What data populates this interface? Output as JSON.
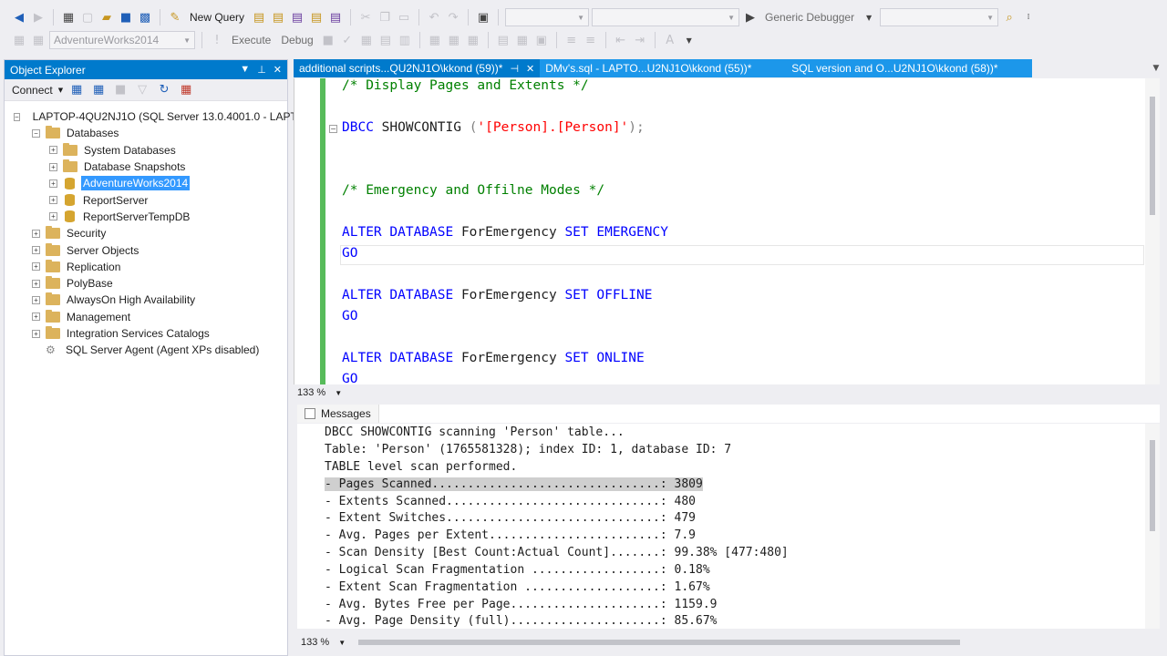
{
  "toolbar1": {
    "new_query_label": "New Query",
    "debugger_label": "Generic Debugger"
  },
  "toolbar2": {
    "database_combo": "AdventureWorks2014",
    "execute_label": "Execute",
    "debug_label": "Debug"
  },
  "object_explorer": {
    "title": "Object Explorer",
    "connect_label": "Connect",
    "tree": [
      {
        "label": "LAPTOP-4QU2NJ1O (SQL Server 13.0.4001.0 - LAPTOP",
        "level": 0,
        "icon": "server"
      },
      {
        "label": "Databases",
        "level": 1,
        "icon": "folder"
      },
      {
        "label": "System Databases",
        "level": 2,
        "icon": "folder"
      },
      {
        "label": "Database Snapshots",
        "level": 2,
        "icon": "folder"
      },
      {
        "label": "AdventureWorks2014",
        "level": 2,
        "icon": "database"
      },
      {
        "label": "ReportServer",
        "level": 2,
        "icon": "database"
      },
      {
        "label": "ReportServerTempDB",
        "level": 2,
        "icon": "database"
      },
      {
        "label": "Security",
        "level": 1,
        "icon": "folder"
      },
      {
        "label": "Server Objects",
        "level": 1,
        "icon": "folder"
      },
      {
        "label": "Replication",
        "level": 1,
        "icon": "folder"
      },
      {
        "label": "PolyBase",
        "level": 1,
        "icon": "folder"
      },
      {
        "label": "AlwaysOn High Availability",
        "level": 1,
        "icon": "folder"
      },
      {
        "label": "Management",
        "level": 1,
        "icon": "folder"
      },
      {
        "label": "Integration Services Catalogs",
        "level": 1,
        "icon": "folder"
      },
      {
        "label": "SQL Server Agent (Agent XPs disabled)",
        "level": 1,
        "icon": "agent"
      }
    ]
  },
  "tabs": [
    {
      "label": "additional scripts...QU2NJ1O\\kkond (59))*",
      "active": true
    },
    {
      "label": "DMv's.sql - LAPTO...U2NJ1O\\kkond (55))*",
      "active": false
    },
    {
      "label": "SQL version and O...U2NJ1O\\kkond (58))*",
      "active": false
    }
  ],
  "editor": {
    "comment1": "/* Display Pages and Extents */",
    "dbcc_kw": "DBCC",
    "dbcc_cmd": " SHOWCONTIG ",
    "dbcc_open": "(",
    "dbcc_str": "'[Person].[Person]'",
    "dbcc_close": ");",
    "comment2": "/* Emergency and Offilne Modes */",
    "l1_kw": "ALTER DATABASE",
    "l1_db": " ForEmergency ",
    "l1_set": "SET EMERGENCY",
    "go": "GO",
    "l2_kw": "ALTER DATABASE",
    "l2_db": " ForEmergency ",
    "l2_set": "SET OFFLINE",
    "l3_kw": "ALTER DATABASE",
    "l3_db": " ForEmergency ",
    "l3_set": "SET ONLINE",
    "zoom": "133 %"
  },
  "results": {
    "tab_label": "Messages",
    "lines": [
      "DBCC SHOWCONTIG scanning 'Person' table...",
      "Table: 'Person' (1765581328); index ID: 1, database ID: 7",
      "TABLE level scan performed.",
      "- Pages Scanned................................: 3809",
      "- Extents Scanned..............................: 480",
      "- Extent Switches..............................: 479",
      "- Avg. Pages per Extent........................: 7.9",
      "- Scan Density [Best Count:Actual Count].......: 99.38% [477:480]",
      "- Logical Scan Fragmentation ..................: 0.18%",
      "- Extent Scan Fragmentation ...................: 1.67%",
      "- Avg. Bytes Free per Page.....................: 1159.9",
      "- Avg. Page Density (full).....................: 85.67%"
    ],
    "zoom": "133 %"
  },
  "colors": {
    "accent": "#007acc",
    "keyword": "#0000ff",
    "comment": "#008000",
    "string": "#ff0000",
    "selection": "#3399ff"
  }
}
